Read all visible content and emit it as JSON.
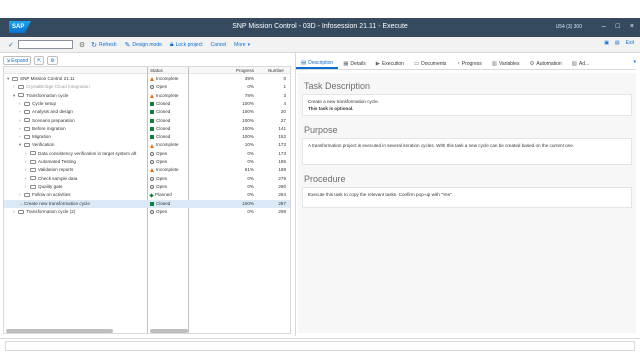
{
  "window": {
    "logo": "SAP",
    "title": "SNP Mission Control - 03D - Infosession 21.11 - Execute",
    "sysinfo": "U54 (3) 300"
  },
  "toolbar": {
    "refresh": "Refresh",
    "design_mode": "Design mode",
    "lock_project": "Lock project",
    "cancel": "Cancel",
    "more": "More",
    "exit": "Exit"
  },
  "subbar": {
    "expand": "Expand"
  },
  "tree": {
    "headers": {
      "status": "Status",
      "progress": "Progress",
      "number": "Number"
    },
    "rows": [
      {
        "name": "SNP Mission Control 21.11",
        "level": 0,
        "exp": "▾",
        "status": "Incomplete",
        "sicon": "tri",
        "progress": "39%",
        "number": "0"
      },
      {
        "name": "CrystalBridge Cloud Integration",
        "level": 1,
        "exp": "›",
        "status": "Open",
        "sicon": "circ",
        "progress": "0%",
        "number": "1",
        "muted": true
      },
      {
        "name": "Transformation cycle",
        "level": 1,
        "exp": "▾",
        "status": "Incomplete",
        "sicon": "tri",
        "progress": "78%",
        "number": "3"
      },
      {
        "name": "Cycle setup",
        "level": 2,
        "exp": "›",
        "status": "Closed",
        "sicon": "sq",
        "progress": "100%",
        "number": "4"
      },
      {
        "name": "Analysis and design",
        "level": 2,
        "exp": "›",
        "status": "Closed",
        "sicon": "sq",
        "progress": "100%",
        "number": "20"
      },
      {
        "name": "Scenario preparation",
        "level": 2,
        "exp": "›",
        "status": "Closed",
        "sicon": "sq",
        "progress": "100%",
        "number": "27"
      },
      {
        "name": "Before migration",
        "level": 2,
        "exp": "›",
        "status": "Closed",
        "sicon": "sq",
        "progress": "100%",
        "number": "141"
      },
      {
        "name": "Migration",
        "level": 2,
        "exp": "›",
        "status": "Closed",
        "sicon": "sq",
        "progress": "100%",
        "number": "152"
      },
      {
        "name": "Verification",
        "level": 2,
        "exp": "▾",
        "status": "Incomplete",
        "sicon": "tri",
        "progress": "10%",
        "number": "172"
      },
      {
        "name": "Data consistency verification in target system aft",
        "level": 3,
        "exp": "›",
        "status": "Open",
        "sicon": "circ",
        "progress": "0%",
        "number": "173"
      },
      {
        "name": "Automated Testing",
        "level": 3,
        "exp": "›",
        "status": "Open",
        "sicon": "circ",
        "progress": "0%",
        "number": "185"
      },
      {
        "name": "Validation reports",
        "level": 3,
        "exp": "›",
        "status": "Incomplete",
        "sicon": "tri",
        "progress": "61%",
        "number": "189"
      },
      {
        "name": "Check sample data",
        "level": 3,
        "exp": "›",
        "status": "Open",
        "sicon": "circ",
        "progress": "0%",
        "number": "279"
      },
      {
        "name": "Quality gate",
        "level": 3,
        "exp": "›",
        "status": "Open",
        "sicon": "circ",
        "progress": "0%",
        "number": "280"
      },
      {
        "name": "Follow on activities",
        "level": 2,
        "exp": "›",
        "status": "Planned",
        "sicon": "dia",
        "progress": "0%",
        "number": "284"
      },
      {
        "name": "Create new transformation cycle",
        "level": 2,
        "exp": "→",
        "status": "Closed",
        "sicon": "sq",
        "progress": "100%",
        "number": "297",
        "selected": true,
        "nofold": true
      },
      {
        "name": "Transformation cycle (2)",
        "level": 1,
        "exp": "›",
        "status": "Open",
        "sicon": "circ",
        "progress": "0%",
        "number": "298"
      }
    ]
  },
  "tabs": [
    {
      "label": "Description",
      "icon": "▤",
      "active": true
    },
    {
      "label": "Details",
      "icon": "▦"
    },
    {
      "label": "Execution",
      "icon": "▶"
    },
    {
      "label": "Documents",
      "icon": "▭"
    },
    {
      "label": "Progress",
      "icon": "◔"
    },
    {
      "label": "Variables",
      "icon": "▥"
    },
    {
      "label": "Automation",
      "icon": "⚙"
    },
    {
      "label": "Ad...",
      "icon": "▧"
    }
  ],
  "description": {
    "task_title": "Task Description",
    "task_line1": "Create a new transformation cycle.",
    "task_line2": "This task is optional.",
    "purpose_title": "Purpose",
    "purpose_text": "A transformation project is executed in several iteration cycles. With this task a new cycle can be created based on the current one.",
    "procedure_title": "Procedure",
    "procedure_text": "Execute this task to copy the relevant tasks. Confirm pop-up with \"Yes\"."
  }
}
